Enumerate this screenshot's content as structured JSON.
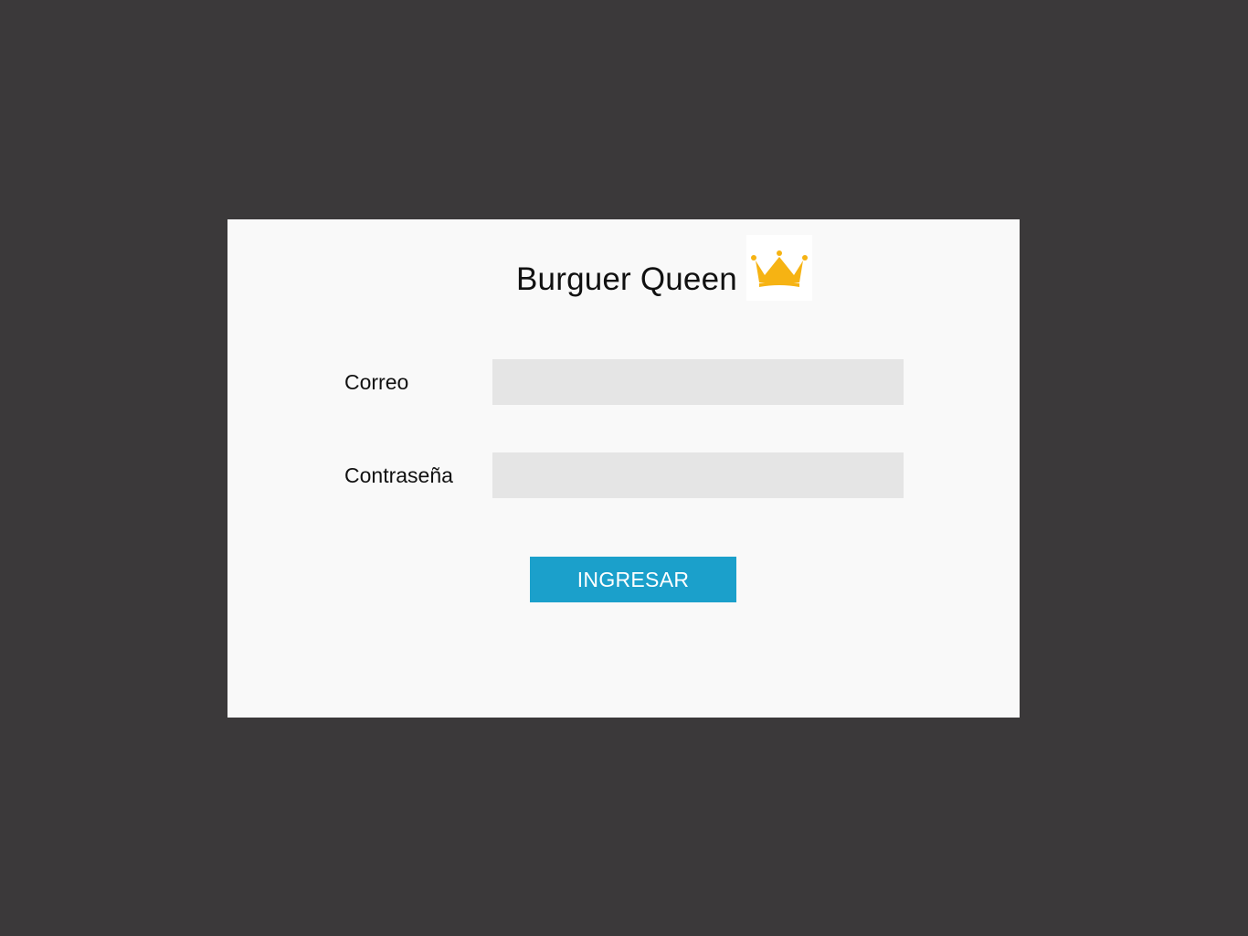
{
  "app": {
    "title": "Burguer Queen",
    "logo_icon": "crown-icon",
    "accent_color": "#1ba0cb",
    "logo_color": "#f6b313"
  },
  "form": {
    "email_label": "Correo",
    "email_value": "",
    "password_label": "Contraseña",
    "password_value": "",
    "submit_label": "INGRESAR"
  }
}
